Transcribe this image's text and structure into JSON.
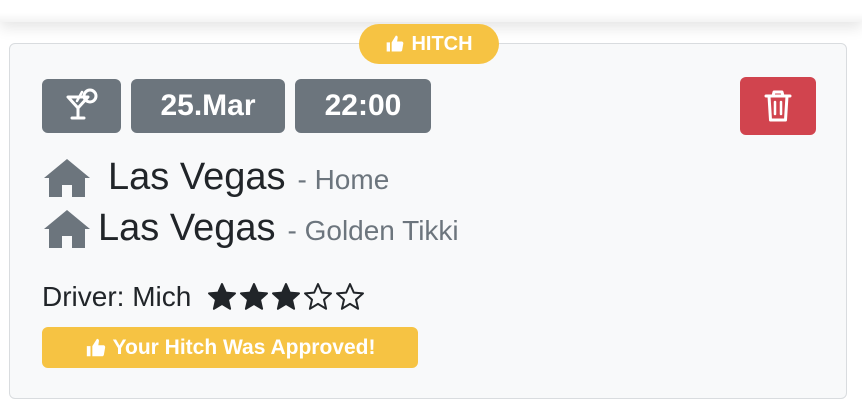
{
  "header_pill": {
    "label": "HITCH",
    "icon": "thumbs-up-icon"
  },
  "badges": {
    "type_icon": "cocktail-icon",
    "date": "25.Mar",
    "time": "22:00"
  },
  "delete_button": {
    "icon": "trash-icon"
  },
  "route": {
    "from": {
      "icon": "home-icon",
      "city": "Las Vegas",
      "place": "- Home"
    },
    "to": {
      "icon": "home-icon",
      "city": "Las Vegas",
      "place": "- Golden Tikki"
    }
  },
  "driver": {
    "label": "Driver: Mich",
    "rating": 3,
    "rating_max": 5
  },
  "status": {
    "icon": "thumbs-up-icon",
    "label": "Your Hitch Was Approved!"
  },
  "colors": {
    "card_background": "#f8f9fa",
    "badge_gray": "#6c757d",
    "warning_yellow": "#f6c343",
    "danger_red": "#d1444e",
    "text_dark": "#212529",
    "text_muted": "#6c757d"
  }
}
